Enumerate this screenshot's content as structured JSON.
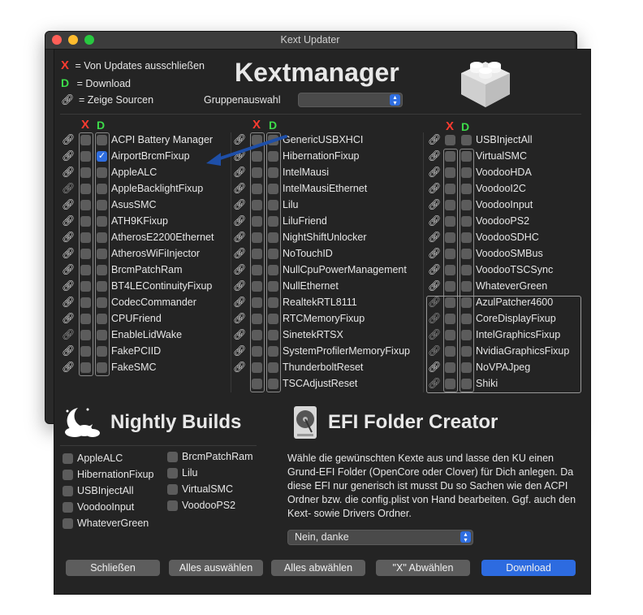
{
  "window": {
    "title": "Kext Updater"
  },
  "legend": {
    "x_letter": "X",
    "x_text": "= Von Updates ausschließen",
    "d_letter": "D",
    "d_text": "= Download",
    "link_text": "= Zeige Sourcen"
  },
  "header": {
    "title": "Kextmanager",
    "group_label": "Gruppenauswahl",
    "group_value": ""
  },
  "columns": {
    "x_header": "X",
    "d_header": "D",
    "col1": [
      {
        "name": "ACPI Battery Manager",
        "link": "on",
        "x": false,
        "d": false
      },
      {
        "name": "AirportBrcmFixup",
        "link": "on",
        "x": false,
        "d": true
      },
      {
        "name": "AppleALC",
        "link": "on",
        "x": false,
        "d": false
      },
      {
        "name": "AppleBacklightFixup",
        "link": "dim",
        "x": false,
        "d": false
      },
      {
        "name": "AsusSMC",
        "link": "on",
        "x": false,
        "d": false
      },
      {
        "name": "ATH9KFixup",
        "link": "on",
        "x": false,
        "d": false
      },
      {
        "name": "AtherosE2200Ethernet",
        "link": "on",
        "x": false,
        "d": false
      },
      {
        "name": "AtherosWiFiInjector",
        "link": "on",
        "x": false,
        "d": false
      },
      {
        "name": "BrcmPatchRam",
        "link": "on",
        "x": false,
        "d": false
      },
      {
        "name": "BT4LEContinuityFixup",
        "link": "on",
        "x": false,
        "d": false
      },
      {
        "name": "CodecCommander",
        "link": "on",
        "x": false,
        "d": false
      },
      {
        "name": "CPUFriend",
        "link": "on",
        "x": false,
        "d": false
      },
      {
        "name": "EnableLidWake",
        "link": "dim",
        "x": false,
        "d": false
      },
      {
        "name": "FakePCIID",
        "link": "on",
        "x": false,
        "d": false
      },
      {
        "name": "FakeSMC",
        "link": "on",
        "x": false,
        "d": false
      }
    ],
    "col2": [
      {
        "name": "GenericUSBXHCI",
        "link": "on"
      },
      {
        "name": "HibernationFixup",
        "link": "on"
      },
      {
        "name": "IntelMausi",
        "link": "on"
      },
      {
        "name": "IntelMausiEthernet",
        "link": "on"
      },
      {
        "name": "Lilu",
        "link": "on"
      },
      {
        "name": "LiluFriend",
        "link": "on"
      },
      {
        "name": "NightShiftUnlocker",
        "link": "on"
      },
      {
        "name": "NoTouchID",
        "link": "on"
      },
      {
        "name": "NullCpuPowerManagement",
        "link": "on"
      },
      {
        "name": "NullEthernet",
        "link": "on"
      },
      {
        "name": "RealtekRTL8111",
        "link": "on"
      },
      {
        "name": "RTCMemoryFixup",
        "link": "on"
      },
      {
        "name": "SinetekRTSX",
        "link": "on"
      },
      {
        "name": "SystemProfilerMemoryFixup",
        "link": "on"
      },
      {
        "name": "ThunderboltReset",
        "link": "on"
      },
      {
        "name": "TSCAdjustReset",
        "link": "none"
      }
    ],
    "col3": [
      {
        "name": "USBInjectAll",
        "link": "on"
      },
      {
        "name": "VirtualSMC",
        "link": "on"
      },
      {
        "name": "VoodooHDA",
        "link": "on"
      },
      {
        "name": "VoodooI2C",
        "link": "on"
      },
      {
        "name": "VoodooInput",
        "link": "on"
      },
      {
        "name": "VoodooPS2",
        "link": "on"
      },
      {
        "name": "VoodooSDHC",
        "link": "on"
      },
      {
        "name": "VoodooSMBus",
        "link": "on"
      },
      {
        "name": "VoodooTSCSync",
        "link": "on"
      },
      {
        "name": "WhateverGreen",
        "link": "on"
      },
      {
        "name": "AzulPatcher4600",
        "link": "dim"
      },
      {
        "name": "CoreDisplayFixup",
        "link": "dim"
      },
      {
        "name": "IntelGraphicsFixup",
        "link": "dim"
      },
      {
        "name": "NvidiaGraphicsFixup",
        "link": "dim"
      },
      {
        "name": "NoVPAJpeg",
        "link": "on"
      },
      {
        "name": "Shiki",
        "link": "dim"
      }
    ]
  },
  "nightly": {
    "title": "Nightly Builds",
    "left": [
      "AppleALC",
      "HibernationFixup",
      "USBInjectAll",
      "VoodooInput",
      "WhateverGreen"
    ],
    "right": [
      "BrcmPatchRam",
      "Lilu",
      "VirtualSMC",
      "VoodooPS2"
    ]
  },
  "efi": {
    "title": "EFI Folder Creator",
    "description": "Wähle die gewünschten Kexte aus und lasse den KU einen Grund-EFI Folder (OpenCore oder Clover) für Dich anlegen. Da diese EFI nur generisch ist musst Du so Sachen wie den ACPI Ordner bzw. die config.plist von Hand bearbeiten. Ggf. auch den Kext- sowie Drivers Ordner.",
    "select_value": "Nein, danke"
  },
  "buttons": {
    "close": "Schließen",
    "select_all": "Alles auswählen",
    "deselect_all": "Alles abwählen",
    "x_select": "\"X\" Abwählen",
    "download": "Download"
  },
  "colors": {
    "accent": "#2d6be0",
    "x_red": "#ff3b30",
    "d_green": "#3ddc4a"
  }
}
